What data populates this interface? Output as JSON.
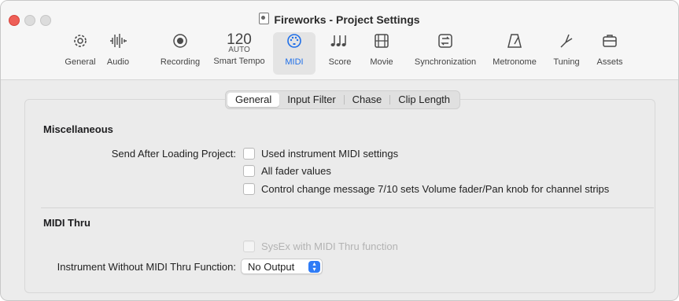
{
  "window": {
    "title": "Fireworks - Project Settings"
  },
  "toolbar": {
    "tabs": [
      {
        "label": "General",
        "icon": "gear-icon"
      },
      {
        "label": "Audio",
        "icon": "waveform-icon"
      },
      {
        "label": "Recording",
        "icon": "record-icon"
      },
      {
        "label": "Smart Tempo",
        "icon": "tempo-display",
        "value": "120",
        "sub": "AUTO"
      },
      {
        "label": "MIDI",
        "icon": "midi-connector-icon",
        "active": true
      },
      {
        "label": "Score",
        "icon": "notes-icon"
      },
      {
        "label": "Movie",
        "icon": "film-icon"
      },
      {
        "label": "Synchronization",
        "icon": "sync-icon"
      },
      {
        "label": "Metronome",
        "icon": "metronome-icon"
      },
      {
        "label": "Tuning",
        "icon": "tuning-fork-icon"
      },
      {
        "label": "Assets",
        "icon": "briefcase-icon"
      }
    ],
    "accent": "#1f6fe8"
  },
  "segments": [
    {
      "label": "General",
      "active": true
    },
    {
      "label": "Input Filter"
    },
    {
      "label": "Chase"
    },
    {
      "label": "Clip Length"
    }
  ],
  "misc": {
    "heading": "Miscellaneous",
    "send_label": "Send After Loading Project:",
    "options": [
      {
        "label": "Used instrument MIDI settings",
        "checked": false
      },
      {
        "label": "All fader values",
        "checked": false
      },
      {
        "label": "Control change message 7/10 sets Volume fader/Pan knob for channel strips",
        "checked": false
      }
    ]
  },
  "midi_thru": {
    "heading": "MIDI Thru",
    "sysex_label": "SysEx with MIDI Thru function",
    "sysex_enabled": false,
    "instrument_label": "Instrument Without MIDI Thru Function:",
    "instrument_value": "No Output"
  }
}
